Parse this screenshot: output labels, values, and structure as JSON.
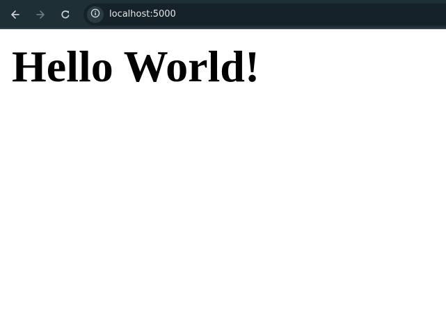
{
  "browser": {
    "url": "localhost:5000",
    "back_icon": "arrow-left-icon",
    "forward_icon": "arrow-right-icon",
    "reload_icon": "reload-icon",
    "site_info_icon": "info-icon",
    "toolbar_color": "#1f2f36",
    "omnibox_color": "#152229"
  },
  "page": {
    "heading": "Hello World!"
  }
}
